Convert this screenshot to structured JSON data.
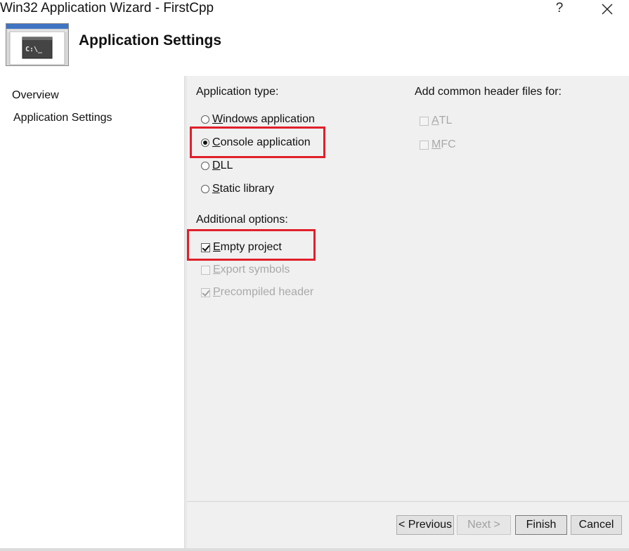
{
  "window": {
    "title": "Win32 Application Wizard - FirstCpp",
    "help_glyph": "?",
    "close_icon": "close-icon"
  },
  "banner": {
    "icon": "console-window-icon",
    "icon_text": "C:\\_",
    "title": "Application Settings"
  },
  "sidebar": {
    "items": [
      {
        "label": "Overview",
        "selected": false
      },
      {
        "label": "Application Settings",
        "selected": true
      }
    ]
  },
  "application_type": {
    "label": "Application type:",
    "options": [
      {
        "mnemonic": "W",
        "rest": "indows application",
        "checked": false
      },
      {
        "mnemonic": "C",
        "rest": "onsole application",
        "checked": true
      },
      {
        "mnemonic": "D",
        "rest": "LL",
        "checked": false
      },
      {
        "mnemonic": "S",
        "rest": "tatic library",
        "checked": false
      }
    ]
  },
  "additional_options": {
    "label": "Additional options:",
    "options": [
      {
        "mnemonic": "E",
        "rest": "mpty project",
        "checked": true,
        "enabled": true
      },
      {
        "mnemonic": "E",
        "rest": "xport symbols",
        "checked": false,
        "enabled": false
      },
      {
        "mnemonic": "P",
        "rest": "recompiled header",
        "checked": true,
        "enabled": false
      }
    ]
  },
  "header_files": {
    "label": "Add common header files for:",
    "options": [
      {
        "mnemonic": "A",
        "rest": "TL",
        "checked": false,
        "enabled": false
      },
      {
        "mnemonic": "M",
        "rest": "FC",
        "checked": false,
        "enabled": false
      }
    ]
  },
  "footer": {
    "previous": "< Previous",
    "next": "Next >",
    "finish": "Finish",
    "cancel": "Cancel"
  },
  "colors": {
    "highlight": "#e0202a",
    "panel_bg": "#f0f0f0",
    "disabled_text": "#a9a9a9"
  }
}
